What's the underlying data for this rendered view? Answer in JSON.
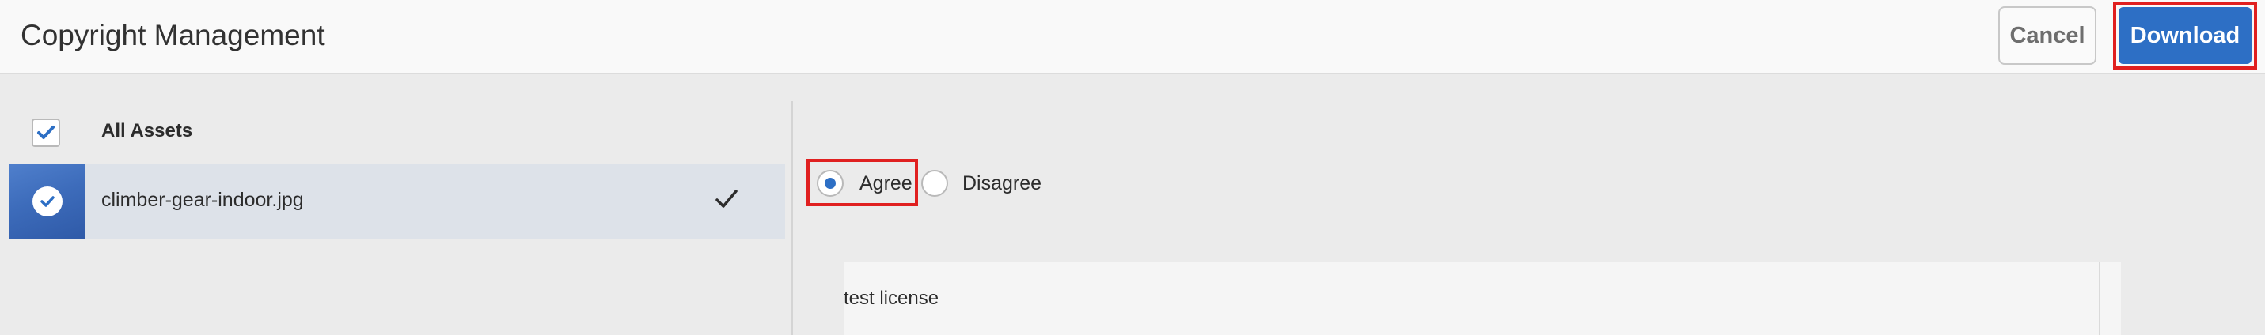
{
  "header": {
    "title": "Copyright Management",
    "cancel_label": "Cancel",
    "download_label": "Download"
  },
  "assets": {
    "all_label": "All Assets",
    "all_checked": true,
    "items": [
      {
        "name": "climber-gear-indoor.jpg",
        "selected": true
      }
    ]
  },
  "agreement": {
    "agree_label": "Agree",
    "disagree_label": "Disagree",
    "selected": "Agree"
  },
  "license": {
    "text": "test license"
  },
  "colors": {
    "accent": "#2d6fc5",
    "highlight": "#e02020",
    "row_selected_bg": "#dde2e9"
  },
  "icons": {
    "check": "checkmark-icon",
    "thumb_check": "check-circle-icon",
    "row_check": "selected-checkmark-icon"
  }
}
